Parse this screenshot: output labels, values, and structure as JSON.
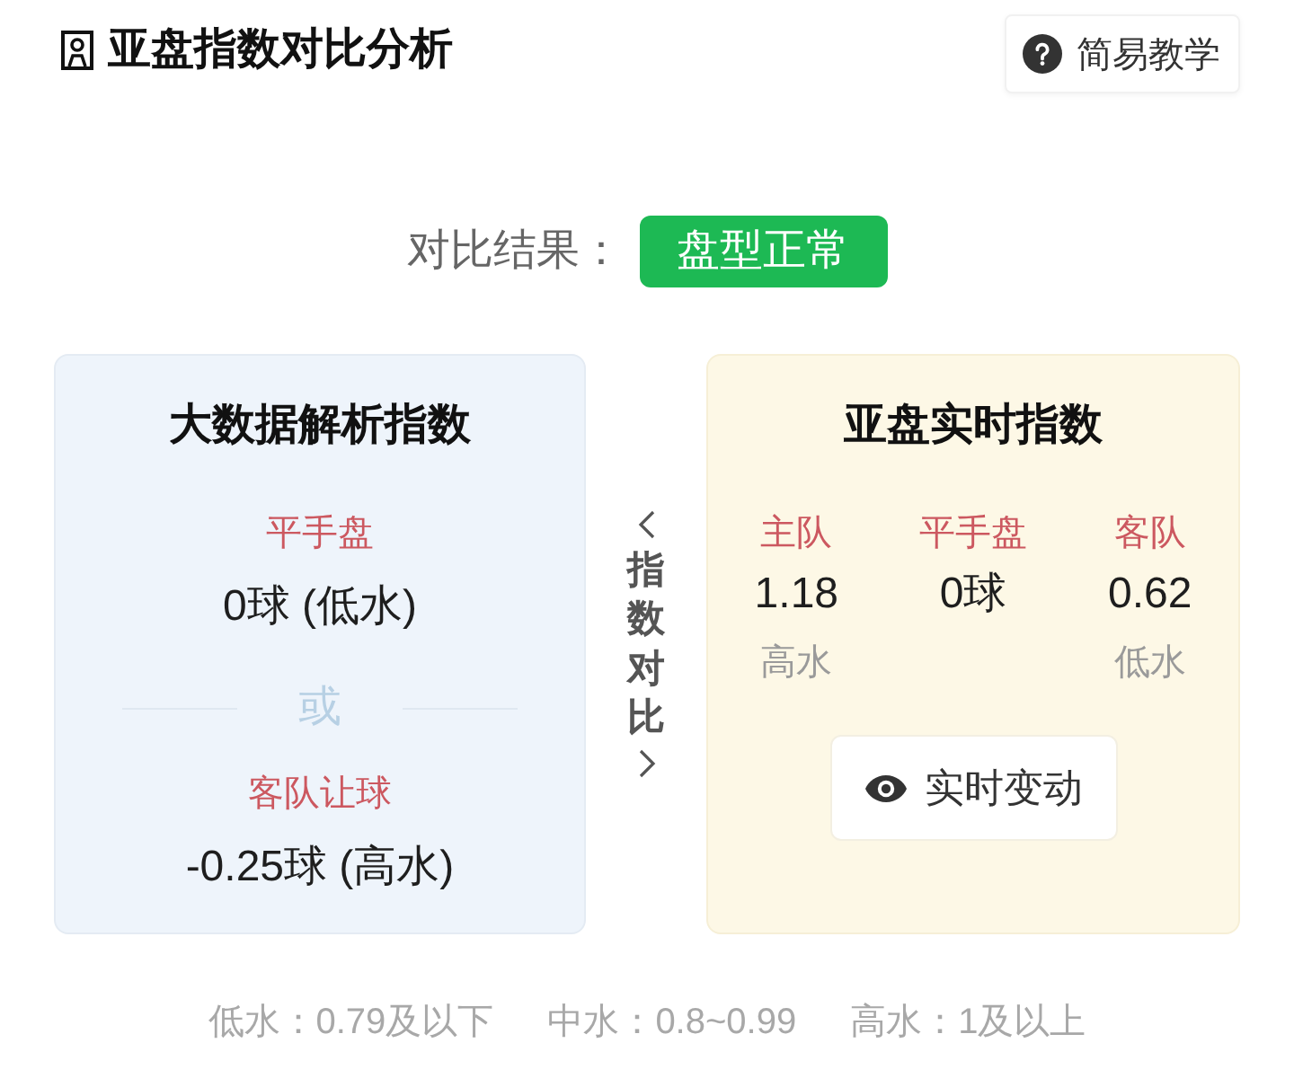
{
  "header": {
    "title": "亚盘指数对比分析",
    "help_button": "简易教学"
  },
  "result": {
    "label": "对比结果：",
    "badge": "盘型正常"
  },
  "analysis_card": {
    "title": "大数据解析指数",
    "options": [
      {
        "label": "平手盘",
        "value": "0球 (低水)"
      },
      {
        "label": "客队让球",
        "value": "-0.25球 (高水)"
      }
    ],
    "separator": "或"
  },
  "compare_toggle": {
    "label": "指数对比"
  },
  "live_card": {
    "title": "亚盘实时指数",
    "columns": [
      {
        "label": "主队",
        "value": "1.18",
        "water": "高水"
      },
      {
        "label": "平手盘",
        "value": "0球"
      },
      {
        "label": "客队",
        "value": "0.62",
        "water": "低水"
      }
    ],
    "button": "实时变动"
  },
  "legend": [
    "低水：0.79及以下",
    "中水：0.8~0.99",
    "高水：1及以上"
  ]
}
